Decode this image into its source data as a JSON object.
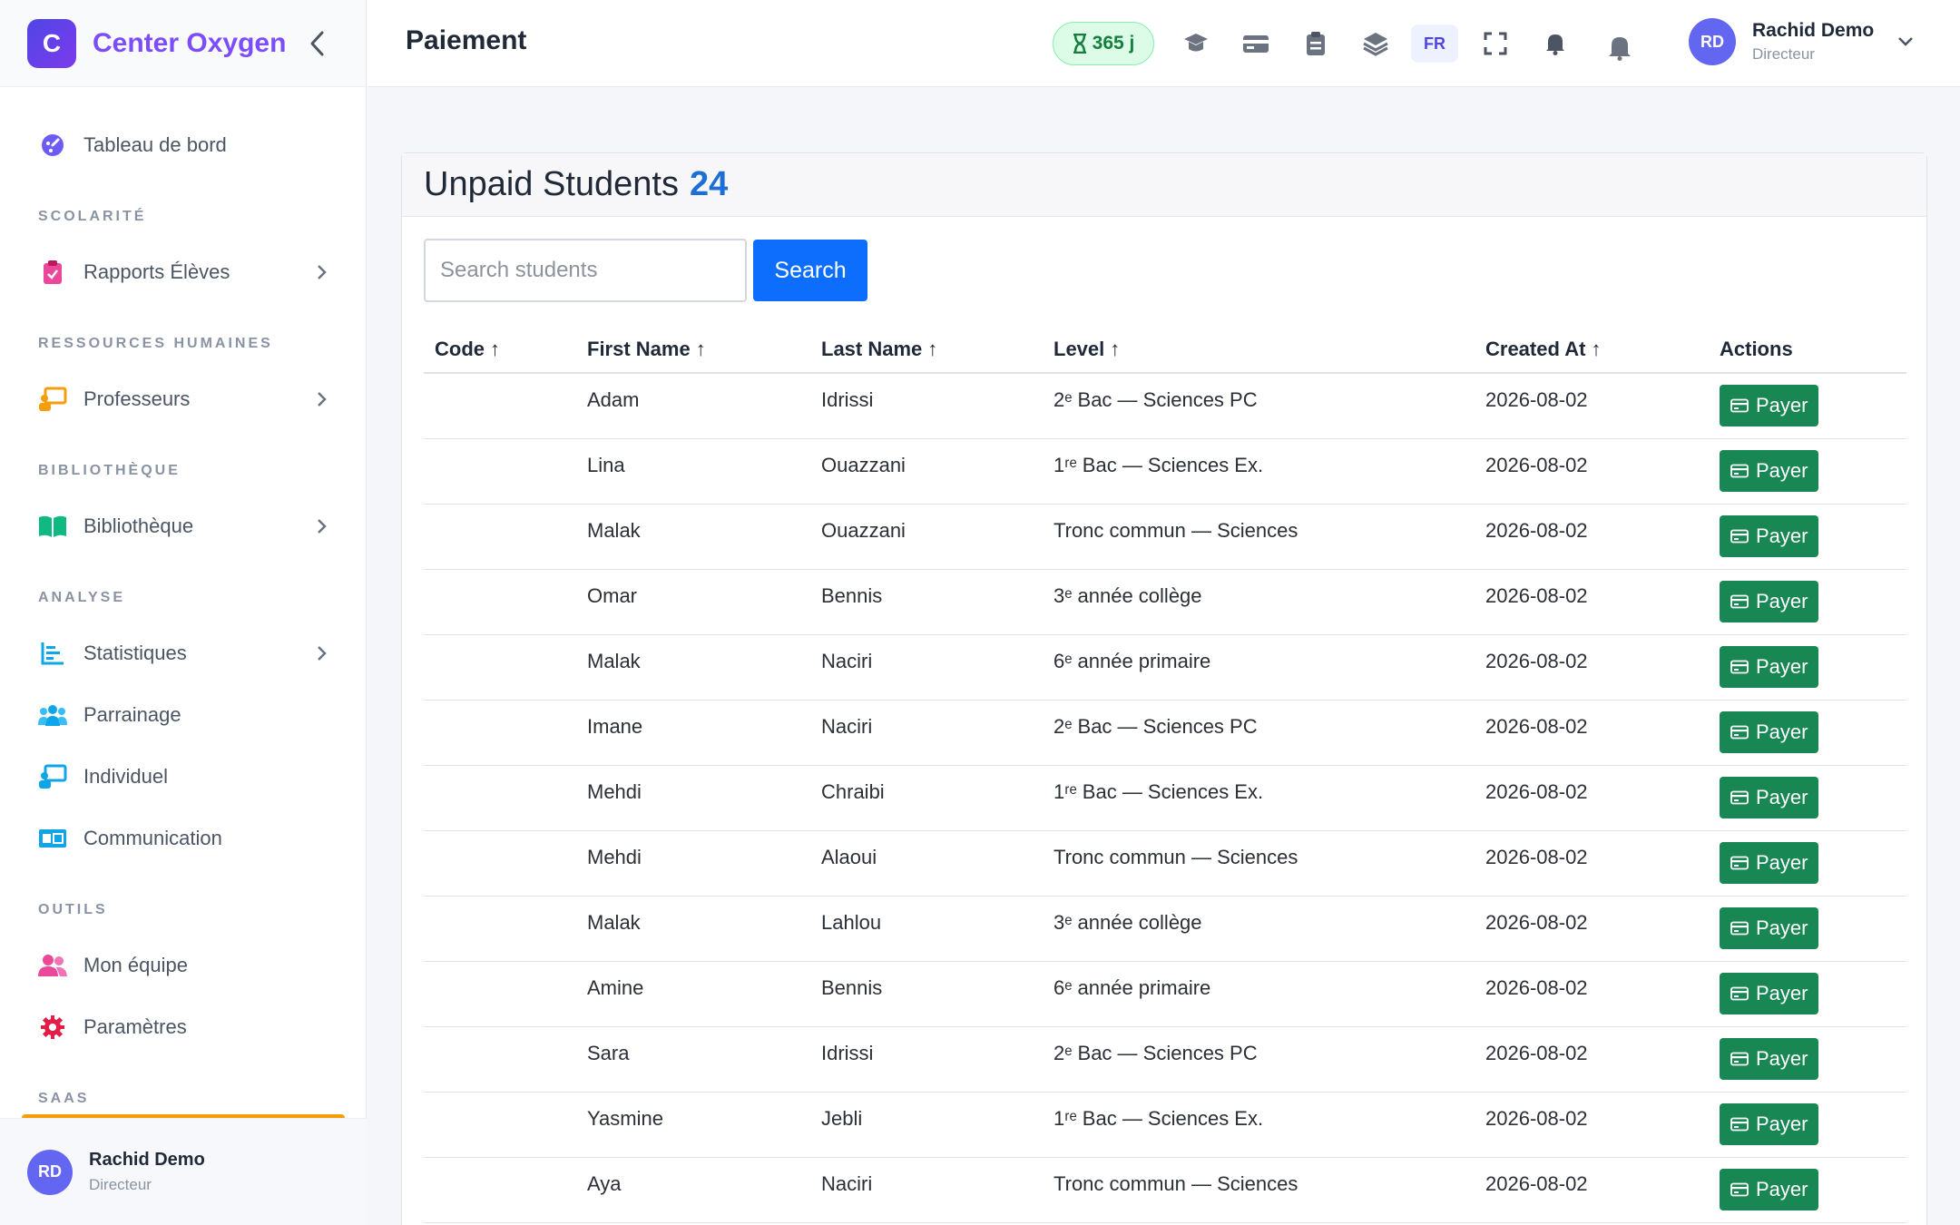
{
  "brand": {
    "logo_letter": "C",
    "name": "Center Oxygen"
  },
  "sidebar": {
    "dashboard": "Tableau de bord",
    "sections": {
      "scolarite": "SCOLARITÉ",
      "rh": "RESSOURCES HUMAINES",
      "biblio": "BIBLIOTHÈQUE",
      "analyse": "ANALYSE",
      "outils": "OUTILS",
      "saas": "SAAS"
    },
    "items": {
      "rapports": "Rapports Élèves",
      "professeurs": "Professeurs",
      "bibliotheque": "Bibliothèque",
      "statistiques": "Statistiques",
      "parrainage": "Parrainage",
      "individuel": "Individuel",
      "communication": "Communication",
      "equipe": "Mon équipe",
      "parametres": "Paramètres"
    },
    "user": {
      "initials": "RD",
      "name": "Rachid Demo",
      "role": "Directeur"
    }
  },
  "topbar": {
    "title": "Paiement",
    "days": "365 j",
    "lang": "FR",
    "user": {
      "initials": "RD",
      "name": "Rachid Demo",
      "role": "Directeur"
    }
  },
  "card": {
    "title": "Unpaid Students",
    "count": "24",
    "search_placeholder": "Search students",
    "search_button": "Search",
    "pay_label": "Payer"
  },
  "table": {
    "columns": [
      "Code",
      "First Name",
      "Last Name",
      "Level",
      "Created At",
      "Actions"
    ],
    "sort_arrow": "↑",
    "rows": [
      {
        "code": "",
        "first": "Adam",
        "last": "Idrissi",
        "level": "2ᵉ Bac — Sciences PC",
        "created": "2026-08-02"
      },
      {
        "code": "",
        "first": "Lina",
        "last": "Ouazzani",
        "level": "1ʳᵉ Bac — Sciences Ex.",
        "created": "2026-08-02"
      },
      {
        "code": "",
        "first": "Malak",
        "last": "Ouazzani",
        "level": "Tronc commun — Sciences",
        "created": "2026-08-02"
      },
      {
        "code": "",
        "first": "Omar",
        "last": "Bennis",
        "level": "3ᵉ année collège",
        "created": "2026-08-02"
      },
      {
        "code": "",
        "first": "Malak",
        "last": "Naciri",
        "level": "6ᵉ année primaire",
        "created": "2026-08-02"
      },
      {
        "code": "",
        "first": "Imane",
        "last": "Naciri",
        "level": "2ᵉ Bac — Sciences PC",
        "created": "2026-08-02"
      },
      {
        "code": "",
        "first": "Mehdi",
        "last": "Chraibi",
        "level": "1ʳᵉ Bac — Sciences Ex.",
        "created": "2026-08-02"
      },
      {
        "code": "",
        "first": "Mehdi",
        "last": "Alaoui",
        "level": "Tronc commun — Sciences",
        "created": "2026-08-02"
      },
      {
        "code": "",
        "first": "Malak",
        "last": "Lahlou",
        "level": "3ᵉ année collège",
        "created": "2026-08-02"
      },
      {
        "code": "",
        "first": "Amine",
        "last": "Bennis",
        "level": "6ᵉ année primaire",
        "created": "2026-08-02"
      },
      {
        "code": "",
        "first": "Sara",
        "last": "Idrissi",
        "level": "2ᵉ Bac — Sciences PC",
        "created": "2026-08-02"
      },
      {
        "code": "",
        "first": "Yasmine",
        "last": "Jebli",
        "level": "1ʳᵉ Bac — Sciences Ex.",
        "created": "2026-08-02"
      },
      {
        "code": "",
        "first": "Aya",
        "last": "Naciri",
        "level": "Tronc commun — Sciences",
        "created": "2026-08-02"
      }
    ]
  },
  "colors": {
    "brand": "#7c4dff",
    "primary": "#0d6efd",
    "success": "#198754",
    "count": "#1d6fd6",
    "saas_accent": "#f59e0b"
  }
}
